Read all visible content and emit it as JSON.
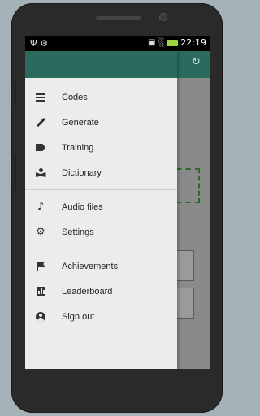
{
  "statusbar": {
    "left_icons": "Ψ ⚙",
    "right_icons": "▣ ░",
    "time": "22:19"
  },
  "drawer": {
    "group_main": [
      {
        "label": "Codes",
        "icon": "list-icon"
      },
      {
        "label": "Generate",
        "icon": "pencil-icon"
      },
      {
        "label": "Training",
        "icon": "tag-icon"
      },
      {
        "label": "Dictionary",
        "icon": "book-icon"
      }
    ],
    "group_media": [
      {
        "label": "Audio files",
        "icon": "music-note-icon"
      },
      {
        "label": "Settings",
        "icon": "gear-icon"
      }
    ],
    "group_account": [
      {
        "label": "Achievements",
        "icon": "flag-icon"
      },
      {
        "label": "Leaderboard",
        "icon": "chart-icon"
      },
      {
        "label": "Sign out",
        "icon": "account-icon"
      }
    ]
  },
  "colors": {
    "toolbar": "#2a6b5e",
    "drawer_bg": "#ececec",
    "battery": "#9fd63a"
  }
}
